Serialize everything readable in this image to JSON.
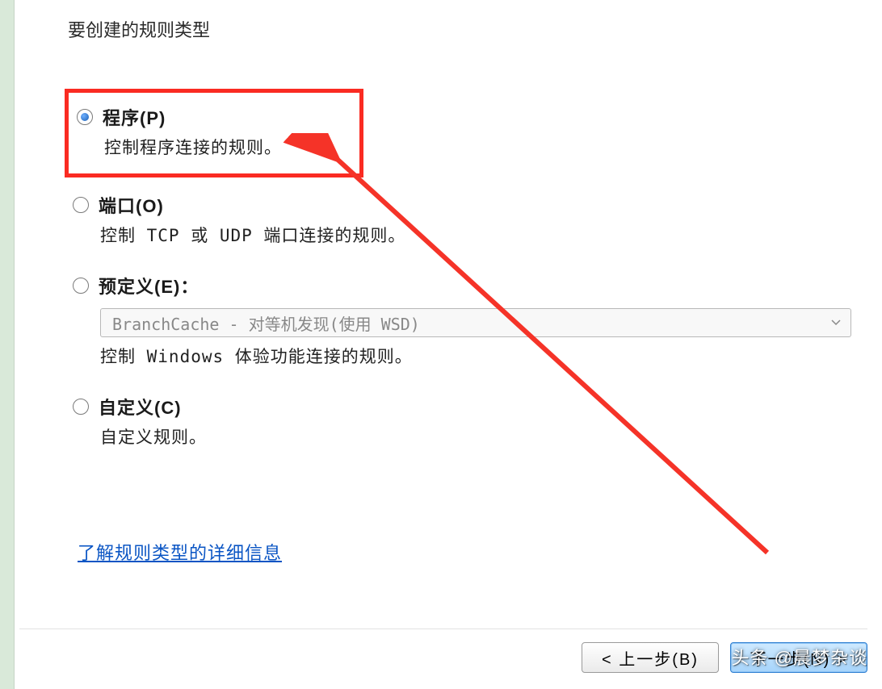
{
  "heading": "要创建的规则类型",
  "options": {
    "program": {
      "title": "程序(P)",
      "desc": "控制程序连接的规则。"
    },
    "port": {
      "title": "端口(O)",
      "desc": "控制 TCP 或 UDP 端口连接的规则。"
    },
    "predefined": {
      "title": "预定义(E)：",
      "dropdown": "BranchCache - 对等机发现(使用 WSD)",
      "desc": "控制 Windows 体验功能连接的规则。"
    },
    "custom": {
      "title": "自定义(C)",
      "desc": "自定义规则。"
    }
  },
  "link": "了解规则类型的详细信息",
  "buttons": {
    "back": "< 上一步(B)",
    "next": "下一步(N) >"
  },
  "watermark": "头条 @晨梦杂谈"
}
